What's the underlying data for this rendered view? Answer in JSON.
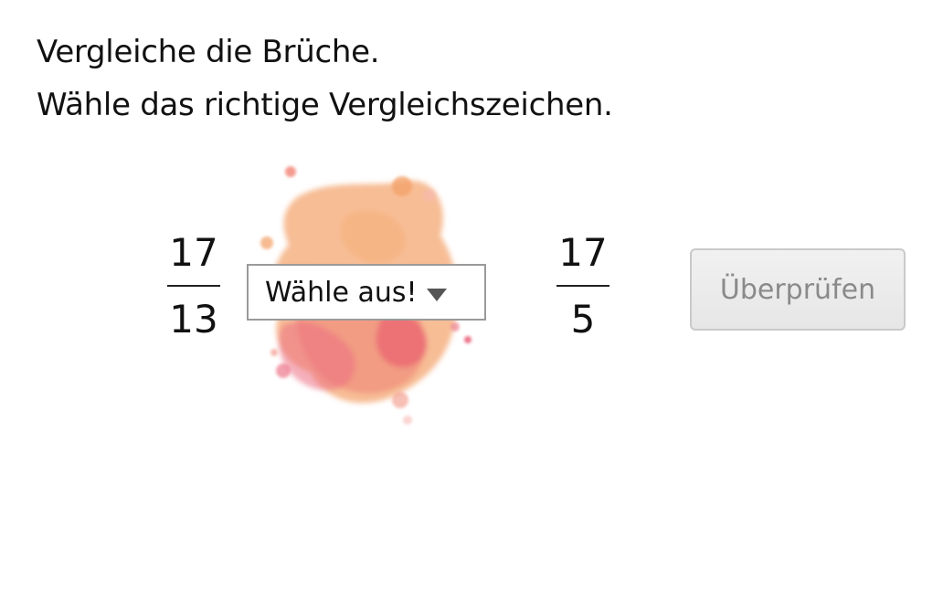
{
  "instructions": {
    "line1": "Vergleiche die Brüche.",
    "line2": "Wähle das richtige Vergleichszeichen."
  },
  "left_fraction": {
    "numerator": "17",
    "denominator": "13"
  },
  "right_fraction": {
    "numerator": "17",
    "denominator": "5"
  },
  "comparison_select": {
    "selected": "Wähle aus!"
  },
  "check_button": {
    "label": "Überprüfen"
  },
  "colors": {
    "splash_orange": "#f4a36c",
    "splash_pink": "#ec6f84",
    "splash_coral": "#f08a7a",
    "splash_red": "#e7516c"
  }
}
